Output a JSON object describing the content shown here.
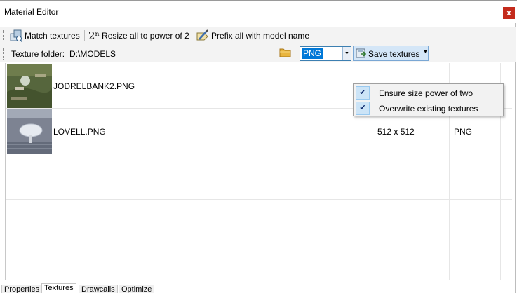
{
  "window": {
    "title": "Material Editor",
    "close_glyph": "x"
  },
  "toolbar": {
    "match_textures": "Match textures",
    "resize_icon_text": "2ⁿ",
    "resize_label": "Resize all to power of 2",
    "prefix_label": "Prefix all with model name"
  },
  "folderbar": {
    "folder_label": "Texture folder:",
    "folder_path": "D:\\MODELS",
    "format_value": "PNG",
    "save_label": "Save textures"
  },
  "save_menu": {
    "items": [
      {
        "label": "Ensure size power of two",
        "checked": true
      },
      {
        "label": "Overwrite existing textures",
        "checked": true
      }
    ]
  },
  "textures": [
    {
      "name": "JODRELBANK2.PNG",
      "size": "",
      "format": ""
    },
    {
      "name": "LOVELL.PNG",
      "size": "512 x 512",
      "format": "PNG"
    }
  ],
  "tabs": [
    {
      "label": "Properties",
      "active": false
    },
    {
      "label": "Textures",
      "active": true
    },
    {
      "label": "Drawcalls",
      "active": false
    },
    {
      "label": "Optimize",
      "active": false
    }
  ],
  "colors": {
    "selection": "#0078d7",
    "close": "#c42b1c",
    "menu_check": "#cce4f7"
  }
}
